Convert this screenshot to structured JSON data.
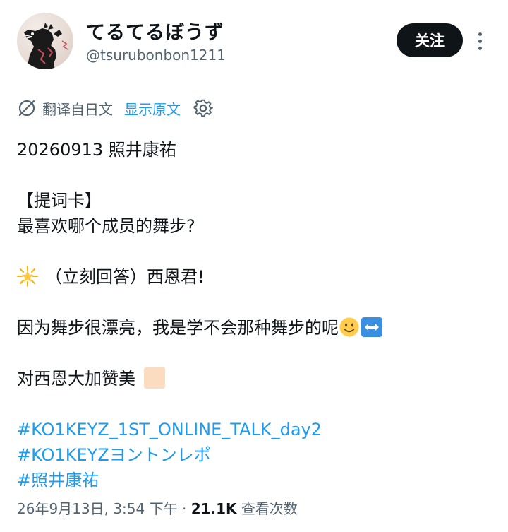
{
  "author": {
    "display_name": "てるてるぼうず",
    "handle": "@tsurubonbon1211",
    "avatar_icon": "dinosaur-avatar"
  },
  "actions": {
    "follow_label": "关注",
    "more_icon": "more-vertical-icon"
  },
  "translation": {
    "icon": "translate-off-icon",
    "label": "翻译自日文",
    "show_original_label": "显示原文",
    "settings_icon": "gear-icon"
  },
  "tweet": {
    "line_1": "20260913 照井康祐",
    "line_2": "【提词卡】",
    "line_3": "最喜欢哪个成员的舞步?",
    "line_4_emoji": "star-emoji",
    "line_4_text": "（立刻回答）西恩君!",
    "line_5_text": "因为舞步很漂亮，我是学不会那种舞步的呢",
    "line_5_emojis": [
      "smiling-face-emoji",
      "left-right-arrow-emoji"
    ],
    "line_6_text": "对西恩大加赞美",
    "line_6_emoji": "light-skin-tone-square",
    "hashtags": [
      "#KO1KEYZ_1ST_ONLINE_TALK_day2",
      "#KO1KEYZヨントンレポ",
      "#照井康祐"
    ]
  },
  "meta": {
    "date": "26年9月13日, 3:54 下午",
    "separator": " · ",
    "views_count": "21.1K",
    "views_label": " 查看次数"
  },
  "colors": {
    "text": "#0f1419",
    "secondary": "#536471",
    "link": "#1d9bf0",
    "button_bg": "#0f1419",
    "button_text": "#ffffff"
  }
}
